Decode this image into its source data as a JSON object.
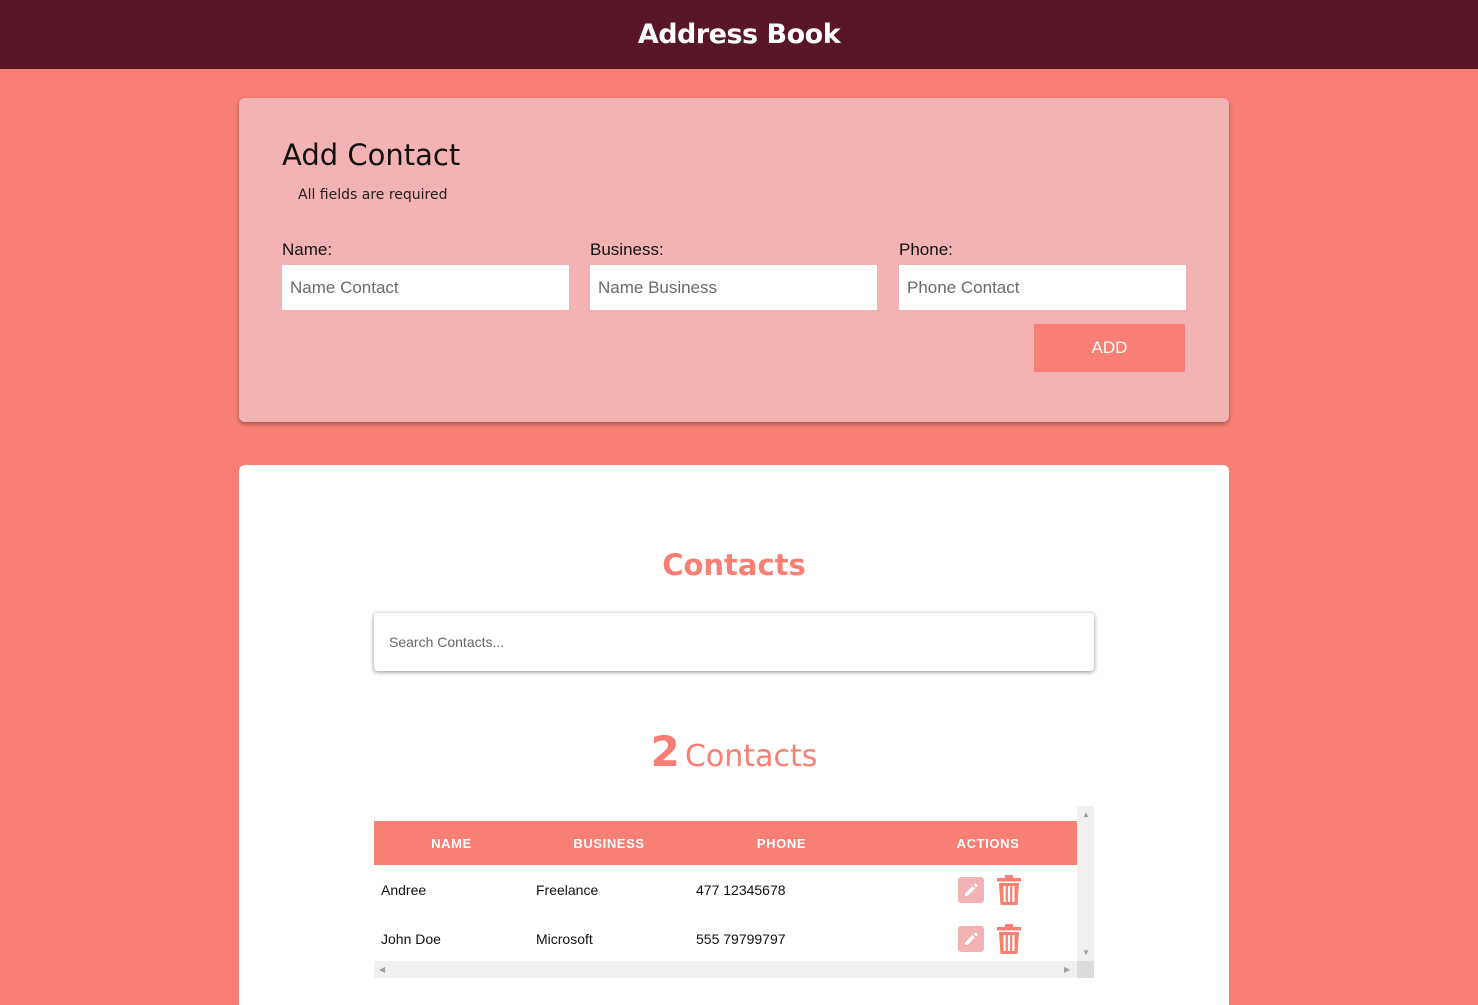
{
  "header": {
    "title": "Address Book"
  },
  "add_form": {
    "title": "Add Contact",
    "subtitle": "All fields are required",
    "fields": [
      {
        "label": "Name:",
        "placeholder": "Name Contact"
      },
      {
        "label": "Business:",
        "placeholder": "Name Business"
      },
      {
        "label": "Phone:",
        "placeholder": "Phone Contact"
      }
    ],
    "add_label": "ADD"
  },
  "contacts": {
    "title": "Contacts",
    "search_placeholder": "Search Contacts...",
    "count": "2",
    "count_word": "Contacts",
    "columns": [
      "NAME",
      "BUSINESS",
      "PHONE",
      "ACTIONS"
    ],
    "rows": [
      {
        "name": "Andree",
        "business": "Freelance",
        "phone": "477 12345678"
      },
      {
        "name": "John Doe",
        "business": "Microsoft",
        "phone": "555 79799797"
      }
    ]
  },
  "icons": {
    "edit": "pencil-icon",
    "delete": "trash-icon"
  },
  "colors": {
    "header_bg": "#5a1629",
    "page_bg": "#f87f74",
    "form_card_bg": "#f3b2b3",
    "accent": "#f87f74"
  }
}
